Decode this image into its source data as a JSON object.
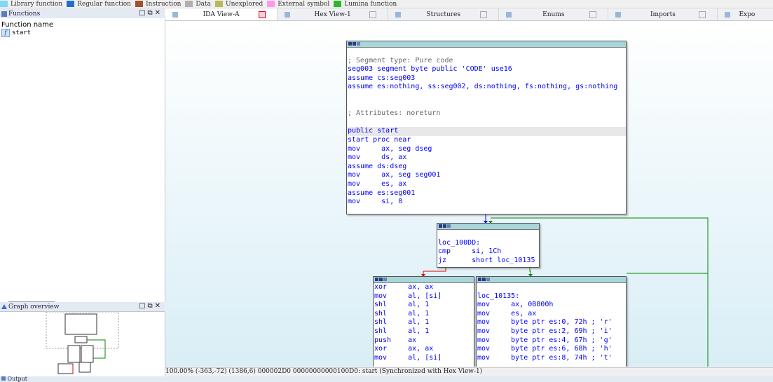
{
  "legend": [
    {
      "label": "Library function",
      "color": "#7fd9f6"
    },
    {
      "label": "Regular function",
      "color": "#1f6fd1"
    },
    {
      "label": "Instruction",
      "color": "#a0522d"
    },
    {
      "label": "Data",
      "color": "#b0b0b0"
    },
    {
      "label": "Unexplored",
      "color": "#b8b85a"
    },
    {
      "label": "External symbol",
      "color": "#ff99ee"
    },
    {
      "label": "Lumina function",
      "color": "#2db82d"
    }
  ],
  "functions_panel": {
    "title": "Functions",
    "column_header": "Function name",
    "items": [
      {
        "name": "start"
      }
    ]
  },
  "overview_panel": {
    "title": "Graph overview"
  },
  "tabs": [
    {
      "label": "IDA View-A",
      "active": true
    },
    {
      "label": "Hex View-1",
      "active": false
    },
    {
      "label": "Structures",
      "active": false
    },
    {
      "label": "Enums",
      "active": false
    },
    {
      "label": "Imports",
      "active": false
    },
    {
      "label": "Expo",
      "active": false
    }
  ],
  "node_main": {
    "lines": [
      "",
      "; Segment type: Pure code",
      "seg003 segment byte public 'CODE' use16",
      "assume cs:seg003",
      "assume es:nothing, ss:seg002, ds:nothing, fs:nothing, gs:nothing",
      "",
      "",
      "; Attributes: noreturn",
      "",
      "public start",
      "start proc near",
      "mov     ax, seg dseg",
      "mov     ds, ax",
      "assume ds:dseg",
      "mov     ax, seg seg001",
      "mov     es, ax",
      "assume es:seg001",
      "mov     si, 0"
    ]
  },
  "node_loop": {
    "lines": [
      "",
      "loc_100DD:",
      "cmp     si, 1Ch",
      "jz      short loc_10135"
    ]
  },
  "node_left": {
    "lines": [
      "xor     ax, ax",
      "mov     al, [si]",
      "shl     al, 1",
      "shl     al, 1",
      "shl     al, 1",
      "shl     al, 1",
      "push    ax",
      "xor     ax, ax",
      "mov     al, [si]"
    ]
  },
  "node_right": {
    "lines": [
      "",
      "loc_10135:",
      "mov     ax, 0B800h",
      "mov     es, ax",
      "mov     byte ptr es:0, 72h ; 'r'",
      "mov     byte ptr es:2, 69h ; 'i'",
      "mov     byte ptr es:4, 67h ; 'g'",
      "mov     byte ptr es:6, 68h ; 'h'",
      "mov     byte ptr es:8, 74h ; 't'"
    ]
  },
  "status": "100.00% (-363,-72) (1386,6) 000002D0 00000000000100D0: start (Synchronized with Hex View-1)",
  "output_panel": {
    "title": "Output"
  }
}
